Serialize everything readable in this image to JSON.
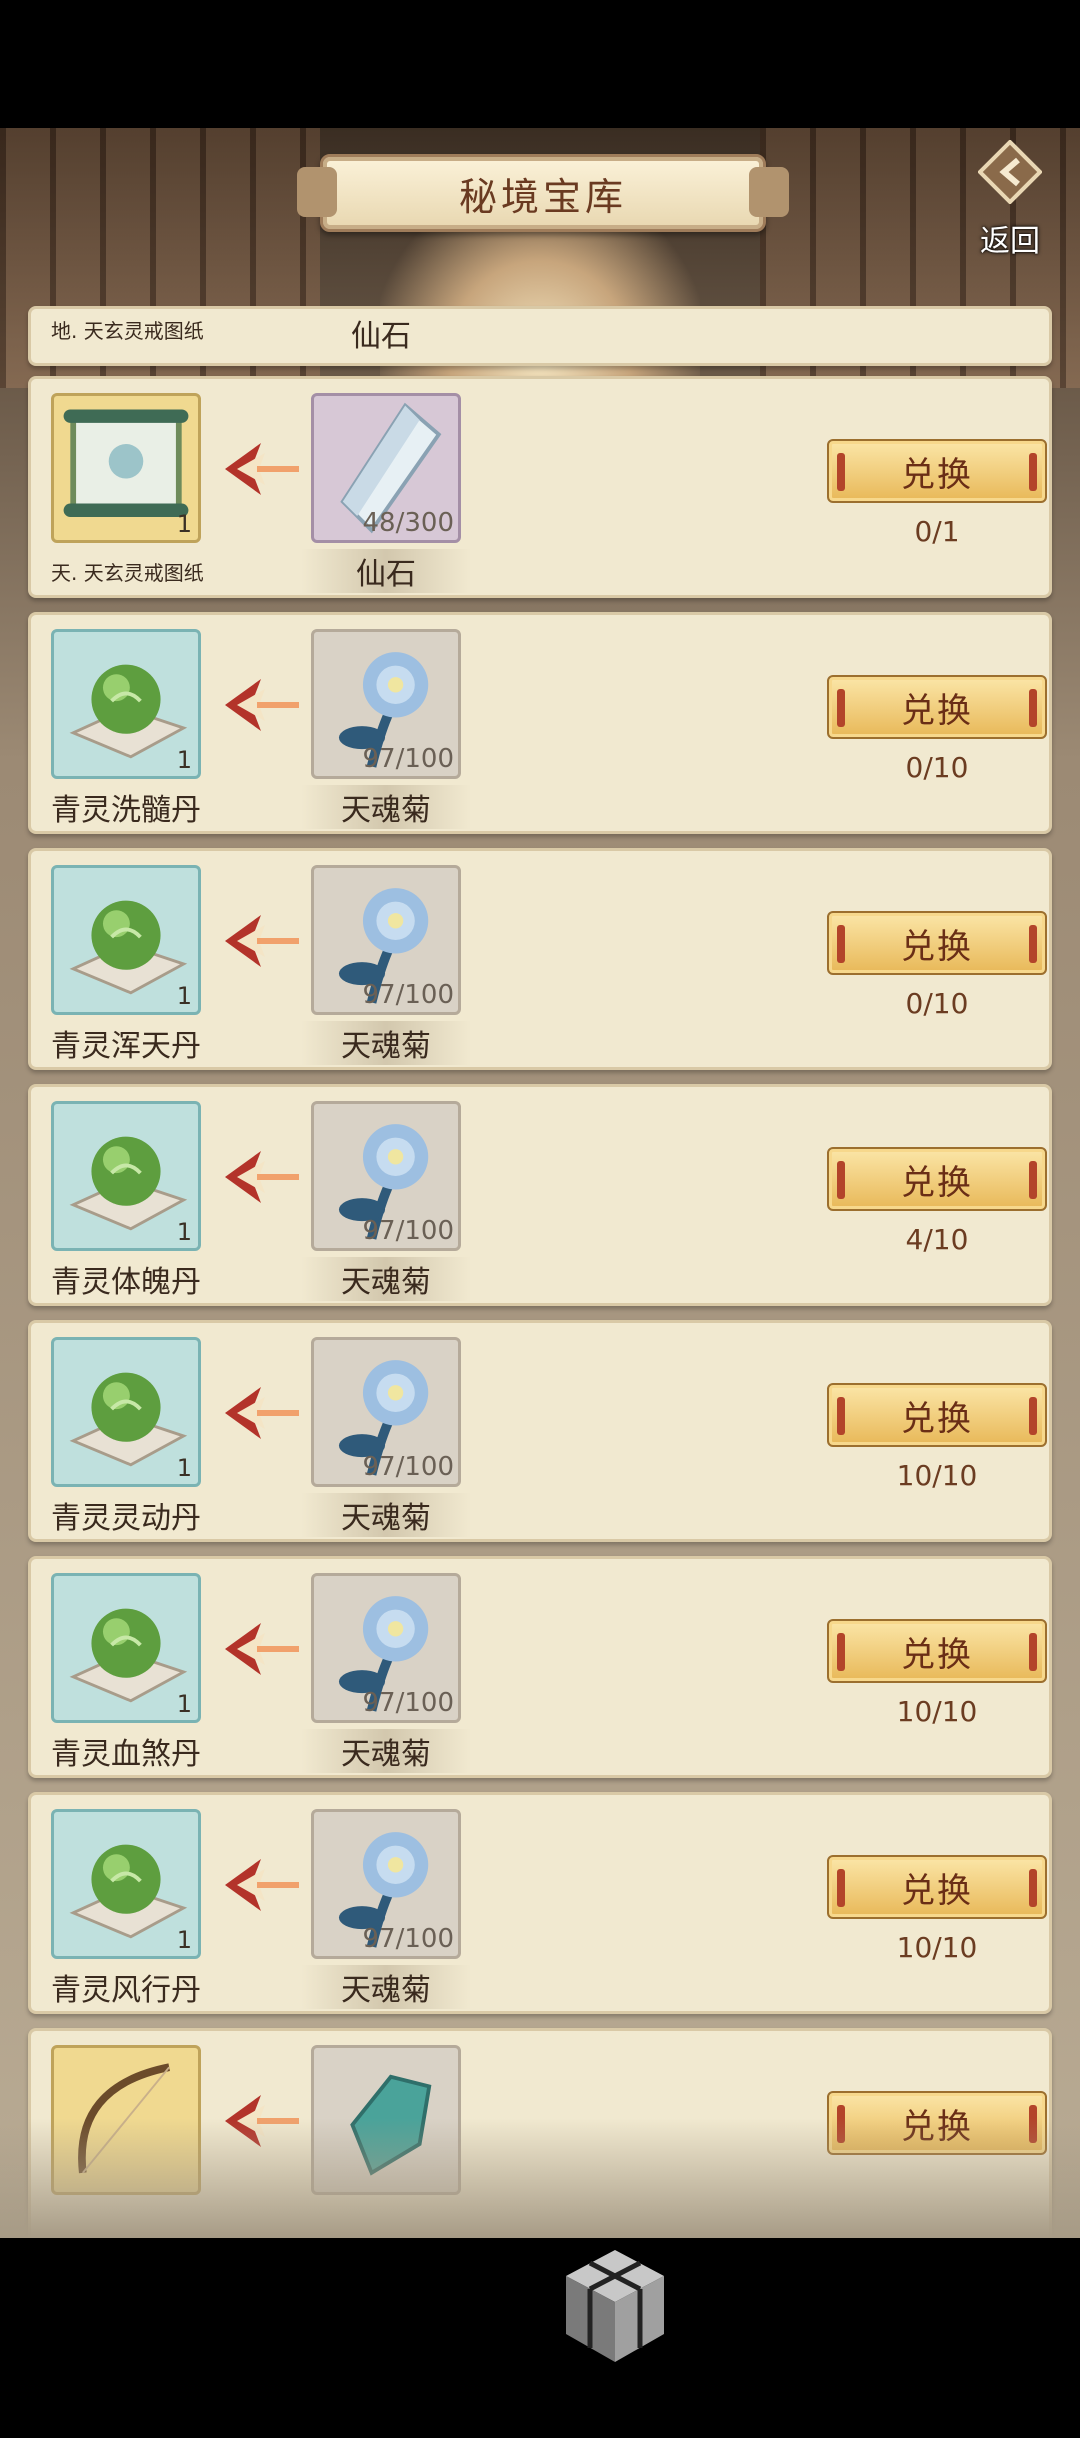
{
  "header": {
    "title": "秘境宝库",
    "back_label": "返回"
  },
  "partial_top": {
    "reward_name": "地. 天玄灵戒图纸",
    "cost_name": "仙石"
  },
  "exchange_label": "兑换",
  "rows": [
    {
      "reward_name": "天. 天玄灵戒图纸",
      "reward_count": "1",
      "reward_icon": "scroll-icon",
      "cost_name": "仙石",
      "cost_count": "48/300",
      "cost_icon": "crystal-icon",
      "progress": "0/1"
    },
    {
      "reward_name": "青灵洗髓丹",
      "reward_count": "1",
      "reward_icon": "pill-icon",
      "cost_name": "天魂菊",
      "cost_count": "97/100",
      "cost_icon": "flower-icon",
      "progress": "0/10"
    },
    {
      "reward_name": "青灵浑天丹",
      "reward_count": "1",
      "reward_icon": "pill-icon",
      "cost_name": "天魂菊",
      "cost_count": "97/100",
      "cost_icon": "flower-icon",
      "progress": "0/10"
    },
    {
      "reward_name": "青灵体魄丹",
      "reward_count": "1",
      "reward_icon": "pill-icon",
      "cost_name": "天魂菊",
      "cost_count": "97/100",
      "cost_icon": "flower-icon",
      "progress": "4/10"
    },
    {
      "reward_name": "青灵灵动丹",
      "reward_count": "1",
      "reward_icon": "pill-icon",
      "cost_name": "天魂菊",
      "cost_count": "97/100",
      "cost_icon": "flower-icon",
      "progress": "10/10"
    },
    {
      "reward_name": "青灵血煞丹",
      "reward_count": "1",
      "reward_icon": "pill-icon",
      "cost_name": "天魂菊",
      "cost_count": "97/100",
      "cost_icon": "flower-icon",
      "progress": "10/10"
    },
    {
      "reward_name": "青灵风行丹",
      "reward_count": "1",
      "reward_icon": "pill-icon",
      "cost_name": "天魂菊",
      "cost_count": "97/100",
      "cost_icon": "flower-icon",
      "progress": "10/10"
    }
  ],
  "partial_bottom": {
    "reward_icon": "bow-icon",
    "cost_icon": "jade-icon"
  }
}
